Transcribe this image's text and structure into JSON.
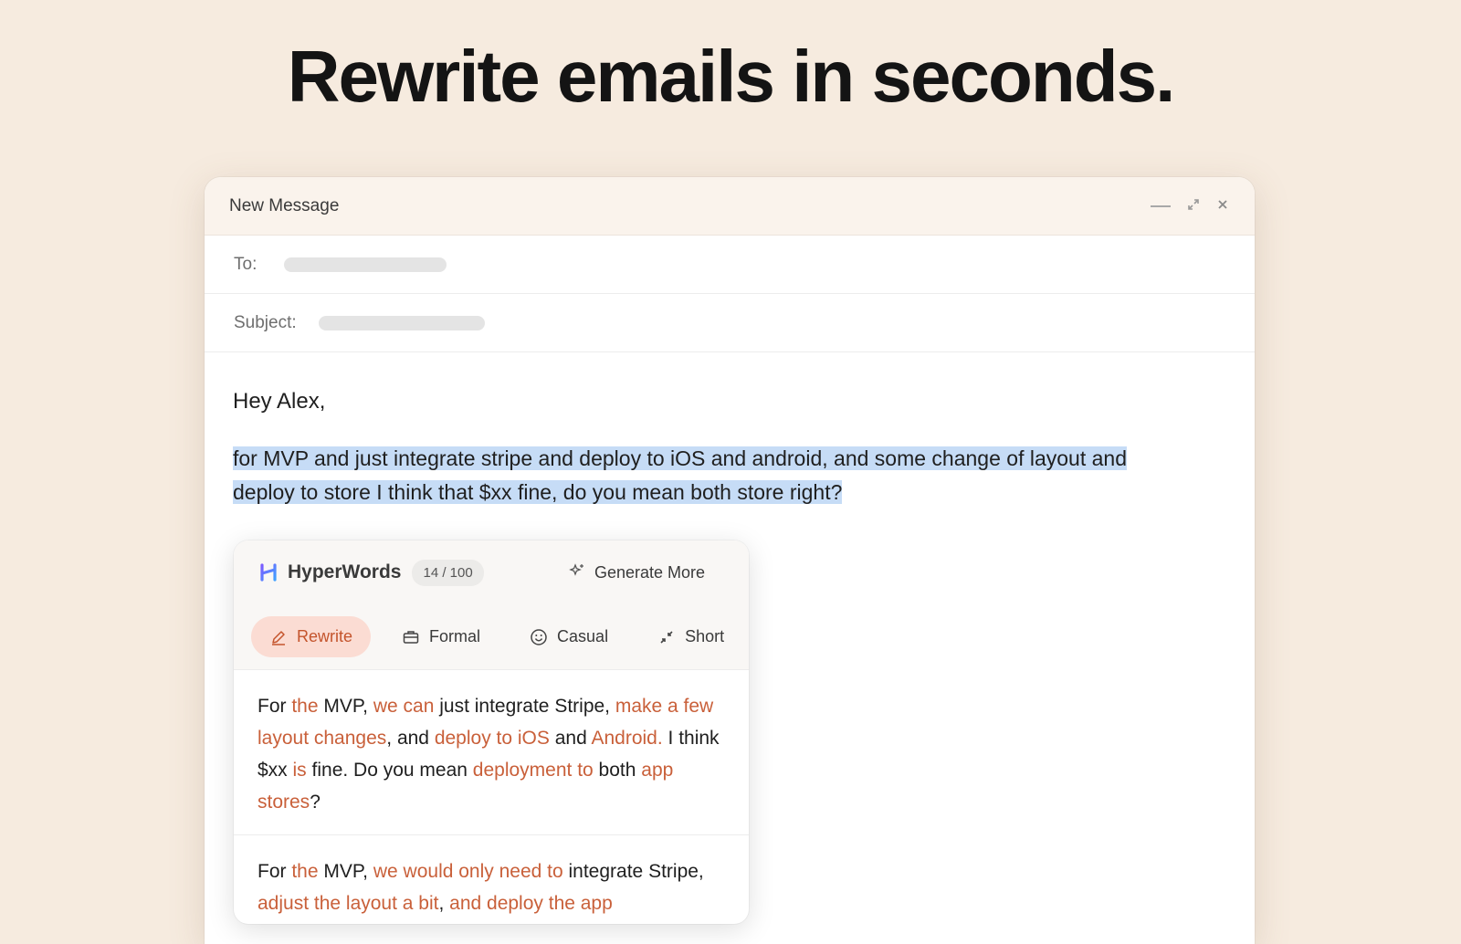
{
  "headline": "Rewrite emails in seconds.",
  "window": {
    "title": "New Message",
    "controls": {
      "minimize": "minimize-icon",
      "expand": "expand-icon",
      "close": "close-icon"
    }
  },
  "fields": {
    "to_label": "To:",
    "subject_label": "Subject:"
  },
  "body": {
    "greeting": "Hey Alex,",
    "selected_line1": "for MVP and just integrate stripe and deploy to iOS and android, and some change of layout and",
    "selected_line2": "deploy to store I think that $xx fine, do you mean both store right?"
  },
  "popup": {
    "brand": "HyperWords",
    "counter": "14 / 100",
    "generate_more": "Generate More",
    "tabs": [
      {
        "label": "Rewrite",
        "icon": "pencil-icon",
        "active": true
      },
      {
        "label": "Formal",
        "icon": "briefcase-icon",
        "active": false
      },
      {
        "label": "Casual",
        "icon": "smiley-icon",
        "active": false
      },
      {
        "label": "Short",
        "icon": "shrink-icon",
        "active": false
      }
    ],
    "suggestions": [
      {
        "parts": [
          {
            "t": "For ",
            "h": false
          },
          {
            "t": "the",
            "h": true
          },
          {
            "t": " MVP, ",
            "h": false
          },
          {
            "t": "we can",
            "h": true
          },
          {
            "t": " just integrate Stripe, ",
            "h": false
          },
          {
            "t": "make a few layout changes",
            "h": true
          },
          {
            "t": ", and ",
            "h": false
          },
          {
            "t": "deploy to iOS",
            "h": true
          },
          {
            "t": " and ",
            "h": false
          },
          {
            "t": "Android.",
            "h": true
          },
          {
            "t": " I think $xx ",
            "h": false
          },
          {
            "t": "is",
            "h": true
          },
          {
            "t": " fine. Do you mean ",
            "h": false
          },
          {
            "t": "deployment to",
            "h": true
          },
          {
            "t": " both ",
            "h": false
          },
          {
            "t": "app stores",
            "h": true
          },
          {
            "t": "?",
            "h": false
          }
        ]
      },
      {
        "parts": [
          {
            "t": "For ",
            "h": false
          },
          {
            "t": "the",
            "h": true
          },
          {
            "t": " MVP, ",
            "h": false
          },
          {
            "t": "we would only need to",
            "h": true
          },
          {
            "t": " integrate Stripe, ",
            "h": false
          },
          {
            "t": "adjust the layout a bit",
            "h": true
          },
          {
            "t": ", ",
            "h": false
          },
          {
            "t": "and deploy the app",
            "h": true
          }
        ]
      }
    ]
  },
  "colors": {
    "background": "#f6ebdf",
    "selection": "#c6dcf6",
    "accent": "#c9603a",
    "active_tab_bg": "#fbdcd3"
  }
}
